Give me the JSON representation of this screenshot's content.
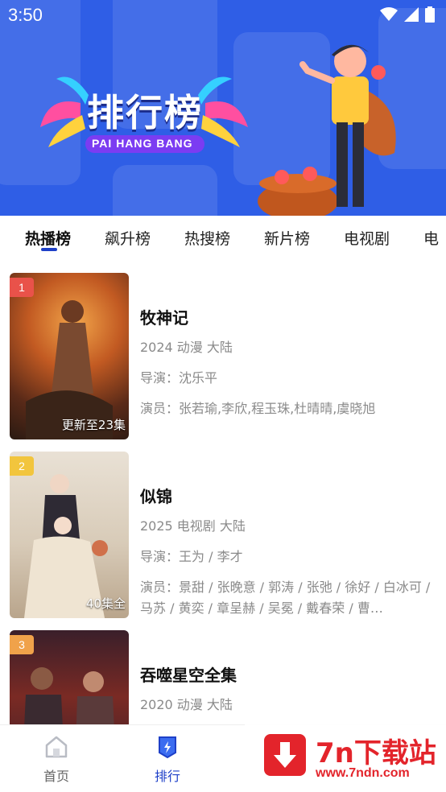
{
  "status_bar": {
    "time": "3:50"
  },
  "banner": {
    "title": "排行榜",
    "subtitle": "PAI HANG BANG"
  },
  "tabs": [
    {
      "label": "热播榜",
      "active": true
    },
    {
      "label": "飙升榜"
    },
    {
      "label": "热搜榜"
    },
    {
      "label": "新片榜"
    },
    {
      "label": "电视剧"
    },
    {
      "label": "电"
    }
  ],
  "items": [
    {
      "rank": "1",
      "rank_color": "#e9524a",
      "episodes": "更新至23集",
      "title": "牧神记",
      "year_genre_region": "2024 动漫 大陆",
      "director": "导演：沈乐平",
      "cast": "演员：张若瑜,李欣,程玉珠,杜晴晴,虞晓旭"
    },
    {
      "rank": "2",
      "rank_color": "#f2c53d",
      "episodes": "40集全",
      "title": "似锦",
      "year_genre_region": "2025 电视剧 大陆",
      "director": "导演：王为 / 李才",
      "cast": "演员：景甜 / 张晚意 / 郭涛 / 张弛 / 徐好 / 白冰可 / 马苏 / 黄奕 / 章呈赫 / 吴冕 / 戴春荣 / 曹…"
    },
    {
      "rank": "3",
      "rank_color": "#f0a24a",
      "episodes": "",
      "title": "吞噬星空全集",
      "year_genre_region": "2020 动漫 大陆",
      "director": "",
      "cast": ""
    }
  ],
  "bottom_nav": [
    {
      "label": "首页",
      "icon": "home-icon",
      "active": false
    },
    {
      "label": "排行",
      "icon": "ranking-icon",
      "active": true
    }
  ],
  "watermark": {
    "main": "7n下载站",
    "url": "www.7ndn.com"
  },
  "colors": {
    "accent": "#1e40c8",
    "banner": "#2f5ee6",
    "watermark_red": "#e3242b"
  }
}
